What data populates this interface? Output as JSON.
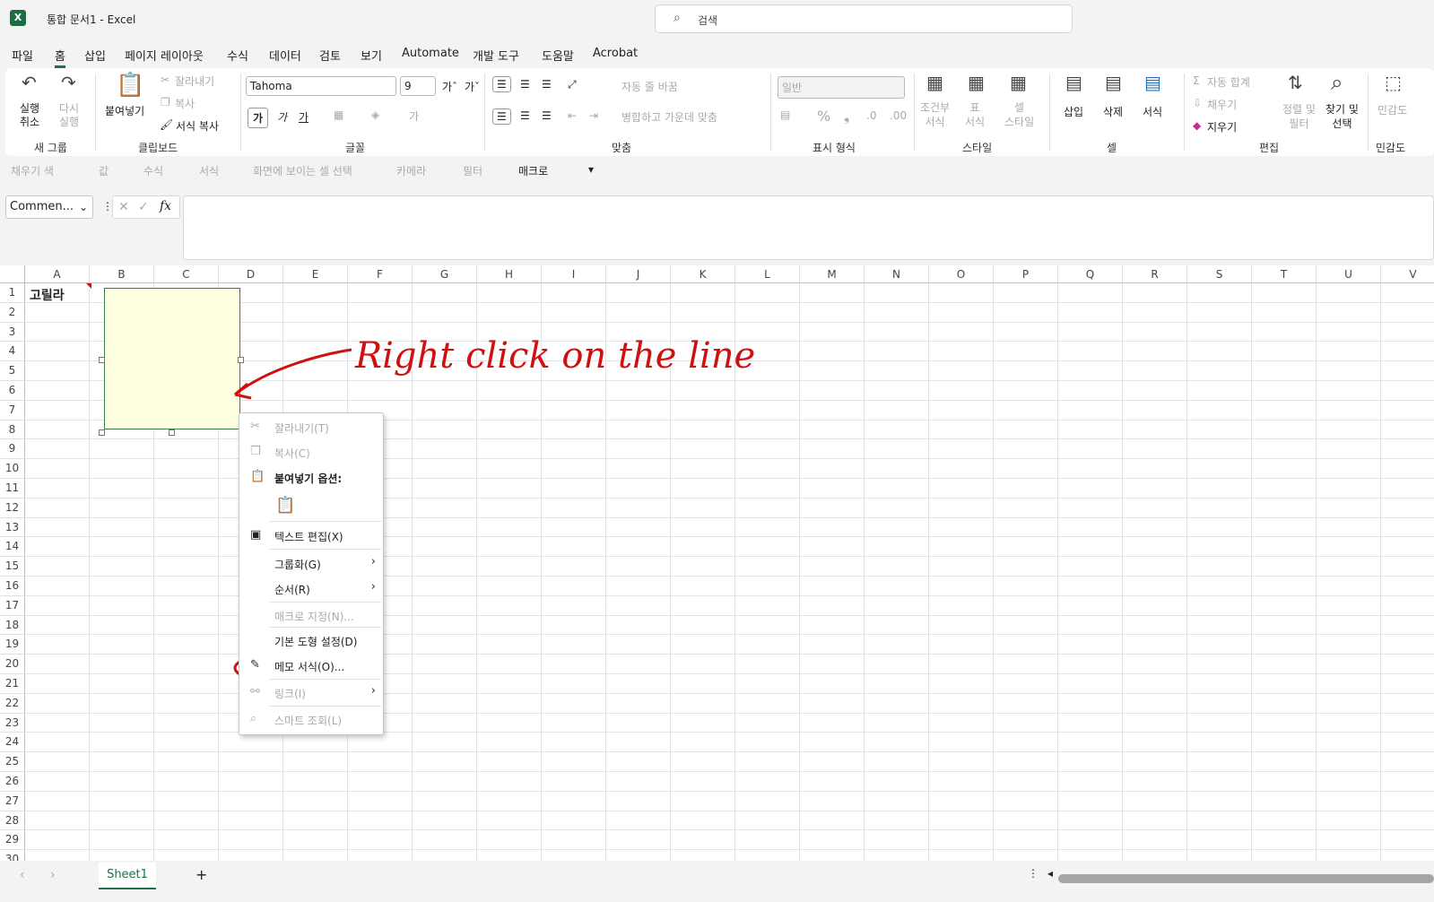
{
  "window": {
    "title": "통합 문서1  -  Excel",
    "app_icon": "X"
  },
  "search": {
    "placeholder": "검색",
    "icon": "search-icon"
  },
  "menu_tabs": [
    "파일",
    "홈",
    "삽입",
    "페이지 레이아웃",
    "수식",
    "데이터",
    "검토",
    "보기",
    "Automate",
    "개발 도구",
    "도움말",
    "Acrobat"
  ],
  "ribbon": {
    "undo": "실행\n취소",
    "redo": "다시\n실행",
    "new_group": "새 그룹",
    "paste": "붙여넣기",
    "cut": "잘라내기",
    "copy": "복사",
    "format_painter": "서식 복사",
    "clipboard": "클립보드",
    "font_name": "Tahoma",
    "font_size": "9",
    "font_group": "글꼴",
    "wrap_text": "자동 줄 바꿈",
    "merge_center": "병합하고 가운데 맞춤",
    "align_group": "맞춤",
    "number_format": "일반",
    "number_group": "표시 형식",
    "cond_format": "조건부\n서식",
    "table_format": "표\n서식",
    "cell_style": "셀\n스타일",
    "style_group": "스타일",
    "insert": "삽입",
    "delete": "삭제",
    "format": "서식",
    "cells_group": "셀",
    "autosum": "자동 합계",
    "fill": "채우기",
    "clear": "지우기",
    "sort_filter": "정렬 및\n필터",
    "find_select": "찾기 및\n선택",
    "edit_group": "편집",
    "sensitivity": "민감도",
    "sensitivity_group": "민감도"
  },
  "qat": [
    "채우기 색",
    "값",
    "수식",
    "서식",
    "화면에 보이는 셀 선택",
    "카메라",
    "필터",
    "매크로"
  ],
  "name_box": "Commen...",
  "columns": [
    "A",
    "B",
    "C",
    "D",
    "E",
    "F",
    "G",
    "H",
    "I",
    "J",
    "K",
    "L",
    "M",
    "N",
    "O",
    "P",
    "Q",
    "R",
    "S",
    "T",
    "U",
    "V"
  ],
  "rows": [
    "1",
    "2",
    "3",
    "4",
    "5",
    "6",
    "7",
    "8",
    "9",
    "10",
    "11",
    "12",
    "13",
    "14",
    "15",
    "16",
    "17",
    "18",
    "19",
    "20",
    "21",
    "22",
    "23",
    "24",
    "25",
    "26",
    "27",
    "28",
    "29",
    "30"
  ],
  "cell_a1": "고릴라",
  "annotation": "Right click on the line",
  "context_menu": {
    "cut": "잘라내기(T)",
    "copy": "복사(C)",
    "paste_options": "붙여넣기 옵션:",
    "edit_text": "텍스트 편집(X)",
    "group": "그룹화(G)",
    "order": "순서(R)",
    "assign_macro": "매크로 지정(N)...",
    "default_shape": "기본 도형 설정(D)",
    "format_comment": "메모 서식(O)...",
    "link": "링크(I)",
    "smart_lookup": "스마트 조회(L)"
  },
  "sheet_tab": "Sheet1",
  "colors": {
    "excel_green": "#1e7145",
    "comment_fill": "#ffffe1",
    "annotation_red": "#d01010"
  }
}
